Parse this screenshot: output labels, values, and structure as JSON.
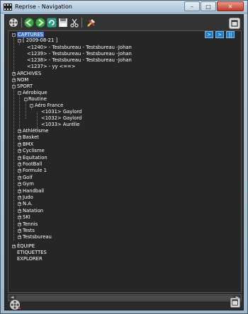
{
  "window": {
    "title": "Reprise - Navigation",
    "minimize_glyph": "–",
    "maximize_glyph": "□",
    "close_glyph": "✕"
  },
  "nav_buttons": {
    "first": ">",
    "next": ">",
    "pause": "||"
  },
  "tree": {
    "captures": "CAPTURES",
    "capture_date": "[ 2009-08-21 ]",
    "captures_items": [
      "<1240> - Testsbureau - Testsbureau -Johan",
      "<1239> - Testsbureau - Testsbureau -Johan",
      "<1238> - Testsbureau - Testsbureau -Johan",
      "<1237> - yy <==>"
    ],
    "archives": "ARCHIVES",
    "nom": "NOM",
    "sport": "SPORT",
    "aerobique": "Aérobique",
    "routine": "Routine",
    "aero_france": "Aéro France",
    "aero_items": [
      "<1031> Gaylord",
      "<1032> Gaylord",
      "<1033> Aurélie"
    ],
    "sports": [
      "Athlétisme",
      "Basket",
      "BMX",
      "Cyclisme",
      "Equitation",
      "FootBall",
      "Formule 1",
      "Golf",
      "Gym",
      "Handball",
      "Judo",
      "N.A.",
      "Natation",
      "SKI",
      "Tennis",
      "Tests",
      "Testsbureau"
    ],
    "equipe": "ÉQUIPE",
    "etiquettes": "ETIQUETTES",
    "explorer": "EXPLORER"
  },
  "icons": {
    "app": "film-reel-icon",
    "toolbar": [
      "film-reel-icon",
      "back-arrow-icon",
      "forward-arrow-icon",
      "refresh-icon",
      "save-icon",
      "cut-icon",
      "tools-icon",
      "window-icon"
    ]
  },
  "colors": {
    "selection": "#3d6fd0",
    "nav_button": "#1e7cc8",
    "background": "#262626"
  }
}
